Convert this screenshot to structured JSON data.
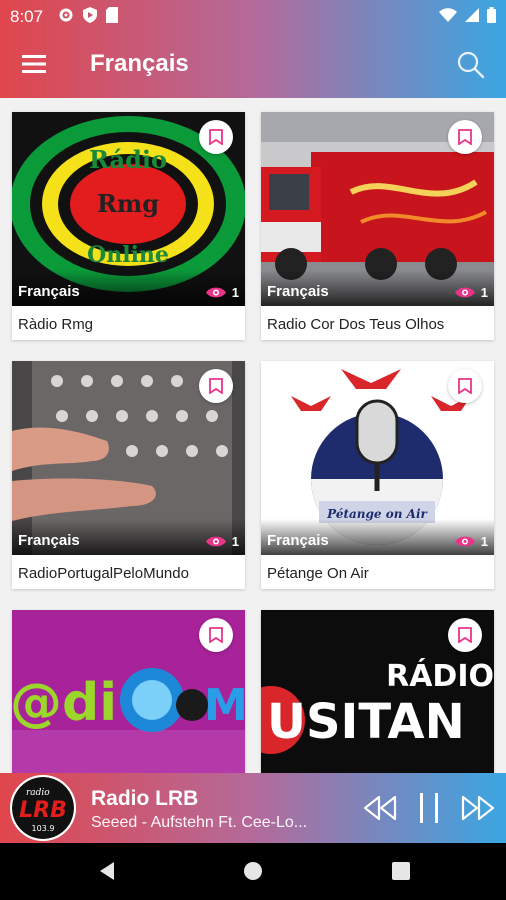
{
  "status_bar": {
    "time": "8:07",
    "left_icons": [
      "gear-icon",
      "shield-icon",
      "sim-card-icon"
    ],
    "right_icons": [
      "wifi-icon",
      "signal-icon",
      "battery-icon"
    ]
  },
  "toolbar": {
    "title": "Français",
    "menu_icon": "hamburger-icon",
    "search_icon": "search-icon"
  },
  "colors": {
    "gradient_start": "#e0464c",
    "gradient_mid": "#b46a9a",
    "gradient_end": "#3aa6e2",
    "accent_pink": "#e8358a"
  },
  "stations": [
    {
      "title": "Ràdio Rmg",
      "language": "Français",
      "views": "1",
      "thumb": "radio-rmg-logo"
    },
    {
      "title": "Radio Cor Dos Teus Olhos",
      "language": "Français",
      "views": "1",
      "thumb": "red-truck-photo"
    },
    {
      "title": "RadioPortugalPeloMundo",
      "language": "Français",
      "views": "1",
      "thumb": "mixing-console-photo"
    },
    {
      "title": "Pétange On Air",
      "language": "Français",
      "views": "1",
      "thumb": "petange-on-air-logo"
    },
    {
      "title": "",
      "language": "",
      "views": "",
      "thumb": "radio-m-logo"
    },
    {
      "title": "",
      "language": "",
      "views": "",
      "thumb": "radio-lusitana-logo"
    }
  ],
  "thumb_text": {
    "rmg_line1": "Rádio",
    "rmg_line2": "Rmg",
    "rmg_line3": "Online",
    "petange_banner": "Pétange on Air",
    "radio_m_text": "@di",
    "radio_m_letter": "M",
    "lusitana_top": "RÁDIO",
    "lusitana_bottom": "USITAN"
  },
  "player": {
    "title": "Radio LRB",
    "subtitle": "Seeed - Aufstehn Ft. Cee-Lo...",
    "logo_text": "LRB",
    "logo_small": "radio",
    "logo_freq": "103.9",
    "controls": [
      "rewind-icon",
      "pause-icon",
      "fast-forward-icon"
    ]
  },
  "nav_bar": [
    "back-icon",
    "home-icon",
    "recents-icon"
  ]
}
